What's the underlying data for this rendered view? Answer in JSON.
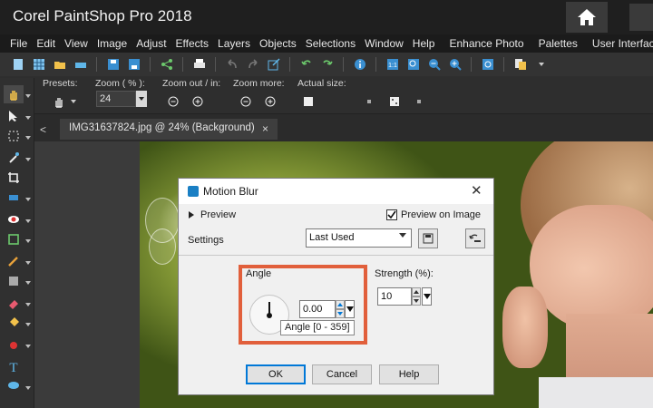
{
  "app": {
    "title": "Corel PaintShop Pro 2018"
  },
  "menu": {
    "items": [
      "File",
      "Edit",
      "View",
      "Image",
      "Adjust",
      "Effects",
      "Layers",
      "Objects",
      "Selections",
      "Window",
      "Help"
    ],
    "extra": [
      "Enhance Photo",
      "Palettes",
      "User Interface"
    ]
  },
  "options": {
    "presets_label": "Presets:",
    "zoom_label": "Zoom ( % ):",
    "zoom_value": "24",
    "zoom_out_in_label": "Zoom out / in:",
    "zoom_more_label": "Zoom more:",
    "actual_size_label": "Actual size:"
  },
  "document": {
    "tab_label": "IMG31637824.jpg @  24% (Background)",
    "prev_symbol": "<",
    "close_symbol": "×"
  },
  "dialog": {
    "title": "Motion Blur",
    "close_symbol": "✕",
    "preview_toggle": "Preview",
    "preview_on_image_label": "Preview on Image",
    "preview_on_image_checked": true,
    "settings_label": "Settings",
    "settings_value": "Last Used",
    "angle_label": "Angle",
    "angle_value": "0.00",
    "angle_tooltip": "Angle [0 - 359]",
    "strength_label": "Strength (%):",
    "strength_value": "10",
    "ok_label": "OK",
    "cancel_label": "Cancel",
    "help_label": "Help"
  },
  "colors": {
    "highlight": "#e15f3b",
    "dialog_accent": "#0078d7"
  }
}
